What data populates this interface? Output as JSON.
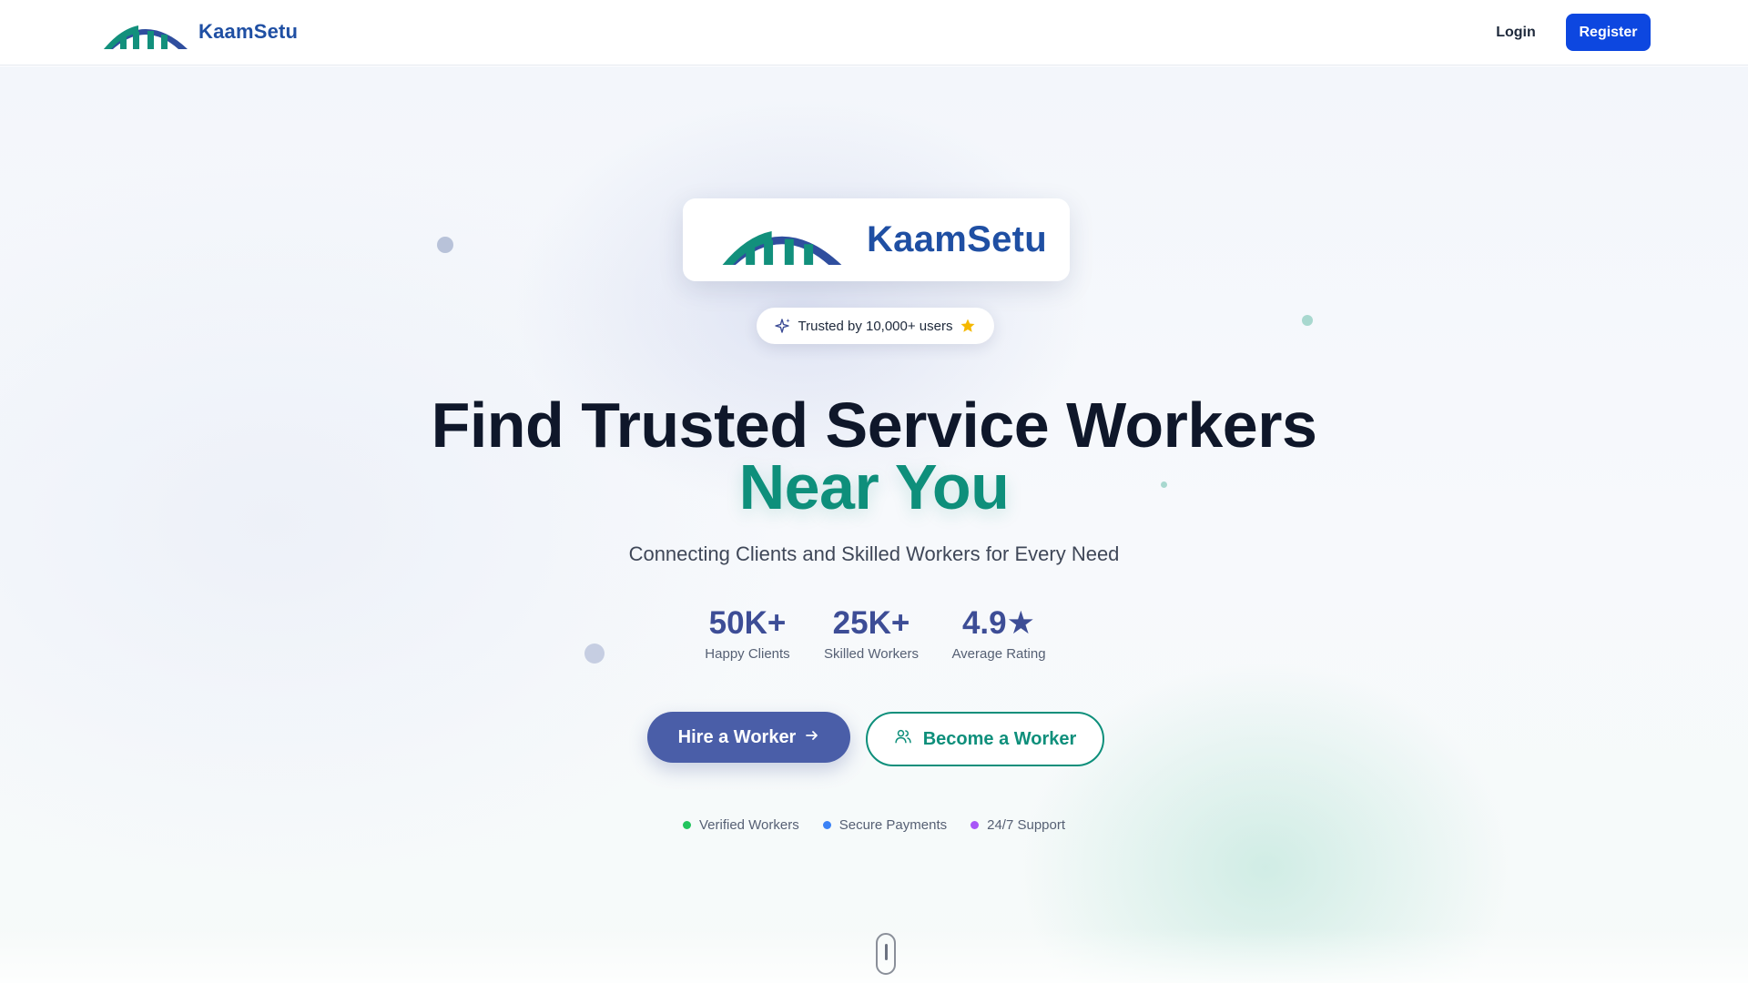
{
  "header": {
    "brand": "KaamSetu",
    "login_label": "Login",
    "register_label": "Register"
  },
  "hero": {
    "logo_brand": "KaamSetu",
    "trust_badge": "Trusted by 10,000+ users",
    "headline_line1": "Find Trusted Service Workers",
    "headline_line2": "Near You",
    "subtitle": "Connecting Clients and Skilled Workers for Every Need",
    "stats": [
      {
        "value": "50K+",
        "label": "Happy Clients"
      },
      {
        "value": "25K+",
        "label": "Skilled Workers"
      },
      {
        "value": "4.9★",
        "label": "Average Rating"
      }
    ],
    "hire_button": "Hire a Worker",
    "become_button": "Become a Worker",
    "features": [
      {
        "label": "Verified Workers",
        "color": "#22c55e"
      },
      {
        "label": "Secure Payments",
        "color": "#3b82f6"
      },
      {
        "label": "24/7 Support",
        "color": "#a855f7"
      }
    ]
  },
  "colors": {
    "brand_blue": "#1f4fa3",
    "accent_teal": "#0e8f7b",
    "register_blue": "#0d47e0",
    "hire_indigo": "#4a5ea8"
  },
  "icons": {
    "logo": "bridge-logo-icon",
    "badge_left": "sparkle-icon",
    "badge_right": "star-icon",
    "hire_arrow": "arrow-right-icon",
    "become": "users-icon",
    "scroll": "mouse-scroll-icon"
  }
}
